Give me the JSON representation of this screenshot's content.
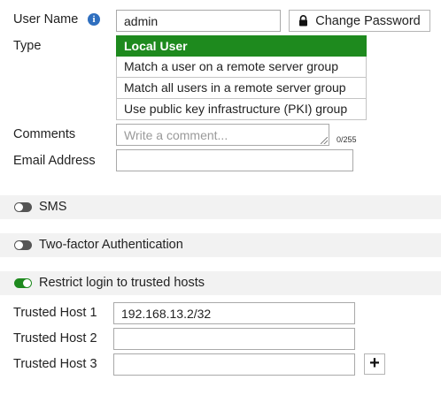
{
  "user_name": {
    "label": "User Name",
    "value": "admin",
    "change_password_label": "Change Password"
  },
  "type": {
    "label": "Type",
    "options": [
      {
        "label": "Local User",
        "selected": true
      },
      {
        "label": "Match a user on a remote server group",
        "selected": false
      },
      {
        "label": "Match all users in a remote server group",
        "selected": false
      },
      {
        "label": "Use public key infrastructure (PKI) group",
        "selected": false
      }
    ]
  },
  "comments": {
    "label": "Comments",
    "placeholder": "Write a comment...",
    "counter": "0/255"
  },
  "email": {
    "label": "Email Address",
    "value": ""
  },
  "sms": {
    "label": "SMS",
    "enabled": false
  },
  "two_factor": {
    "label": "Two-factor Authentication",
    "enabled": false
  },
  "restrict_login": {
    "label": "Restrict login to trusted hosts",
    "enabled": true
  },
  "trusted_hosts": [
    {
      "label": "Trusted Host 1",
      "value": "192.168.13.2/32"
    },
    {
      "label": "Trusted Host 2",
      "value": ""
    },
    {
      "label": "Trusted Host 3",
      "value": ""
    }
  ],
  "colors": {
    "accent_green": "#1e8a1e",
    "info_blue": "#2f6fbf",
    "section_bg": "#f2f2f2"
  },
  "icons": {
    "info": "info-icon",
    "lock": "lock-icon",
    "add": "plus-icon"
  }
}
